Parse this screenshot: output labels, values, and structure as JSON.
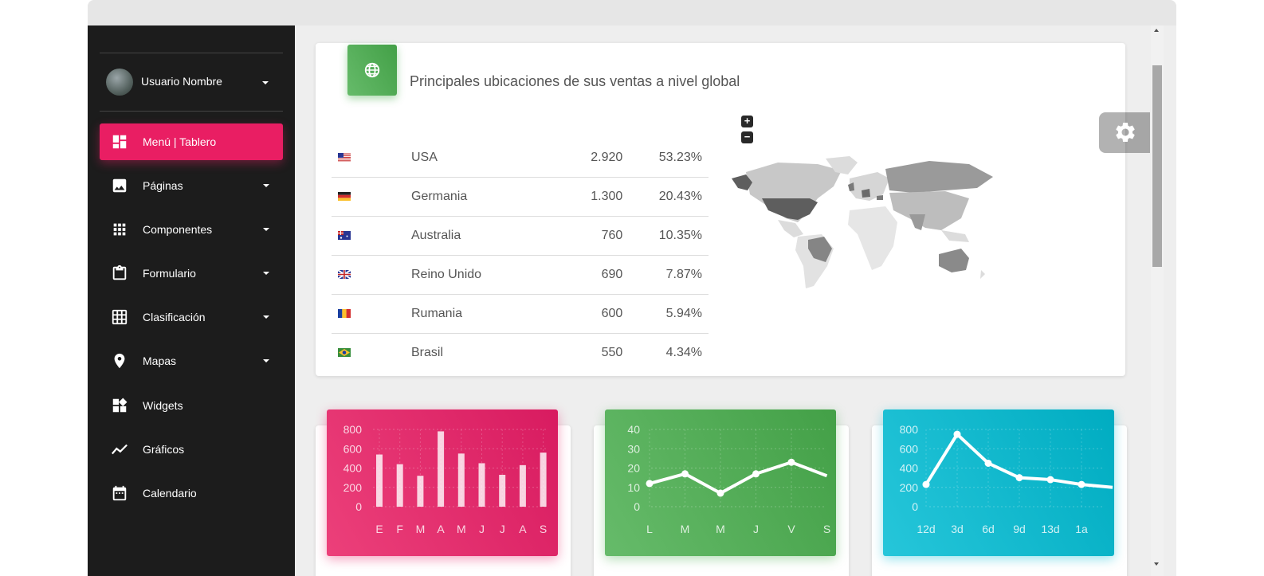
{
  "user": {
    "name": "Usuario Nombre"
  },
  "nav": [
    {
      "label": "Menú | Tablero",
      "icon": "dashboard-icon",
      "active": true
    },
    {
      "label": "Páginas",
      "icon": "image-icon"
    },
    {
      "label": "Componentes",
      "icon": "apps-grid-icon"
    },
    {
      "label": "Formulario",
      "icon": "clipboard-icon"
    },
    {
      "label": "Clasificación",
      "icon": "table-grid-icon"
    },
    {
      "label": "Mapas",
      "icon": "place-pin-icon"
    },
    {
      "label": "Widgets",
      "icon": "widgets-icon"
    },
    {
      "label": "Gráficos",
      "icon": "timeline-chart-icon"
    },
    {
      "label": "Calendario",
      "icon": "calendar-icon"
    }
  ],
  "sales_card": {
    "title": "Principales ubicaciones de sus ventas a nivel global",
    "icon": "globe-icon",
    "countries": [
      {
        "flag": "us-flag-icon",
        "name": "USA",
        "value": "2.920",
        "percent": "53.23%"
      },
      {
        "flag": "de-flag-icon",
        "name": "Germania",
        "value": "1.300",
        "percent": "20.43%"
      },
      {
        "flag": "au-flag-icon",
        "name": "Australia",
        "value": "760",
        "percent": "10.35%"
      },
      {
        "flag": "gb-flag-icon",
        "name": "Reino Unido",
        "value": "690",
        "percent": "7.87%"
      },
      {
        "flag": "ro-flag-icon",
        "name": "Rumania",
        "value": "600",
        "percent": "5.94%"
      },
      {
        "flag": "br-flag-icon",
        "name": "Brasil",
        "value": "550",
        "percent": "4.34%"
      }
    ],
    "map_zoom": {
      "plus": "+",
      "minus": "−"
    }
  },
  "colors": {
    "accent": "#e91e63",
    "green": "#4caf50",
    "cyan": "#00bcd4",
    "sidebar": "#1c1c1c"
  },
  "chart_data": [
    {
      "type": "bar",
      "categories": [
        "E",
        "F",
        "M",
        "A",
        "M",
        "J",
        "J",
        "A",
        "S"
      ],
      "values": [
        540,
        440,
        320,
        780,
        550,
        450,
        330,
        430,
        560
      ],
      "yticks": [
        0,
        200,
        400,
        600,
        800
      ],
      "ylim": [
        0,
        800
      ],
      "grid": true,
      "color": "#e91e63"
    },
    {
      "type": "line",
      "categories": [
        "L",
        "M",
        "M",
        "J",
        "V",
        "S"
      ],
      "values": [
        12,
        17,
        7,
        17,
        23,
        16
      ],
      "yticks": [
        0,
        10,
        20,
        30,
        40
      ],
      "ylim": [
        0,
        40
      ],
      "grid": true,
      "color": "#4caf50"
    },
    {
      "type": "line",
      "categories": [
        "12d",
        "3d",
        "6d",
        "9d",
        "13d",
        "1a",
        ""
      ],
      "values": [
        230,
        750,
        450,
        300,
        280,
        230,
        200
      ],
      "yticks": [
        0,
        200,
        400,
        600,
        800
      ],
      "ylim": [
        0,
        800
      ],
      "grid": true,
      "color": "#00bcd4"
    }
  ]
}
